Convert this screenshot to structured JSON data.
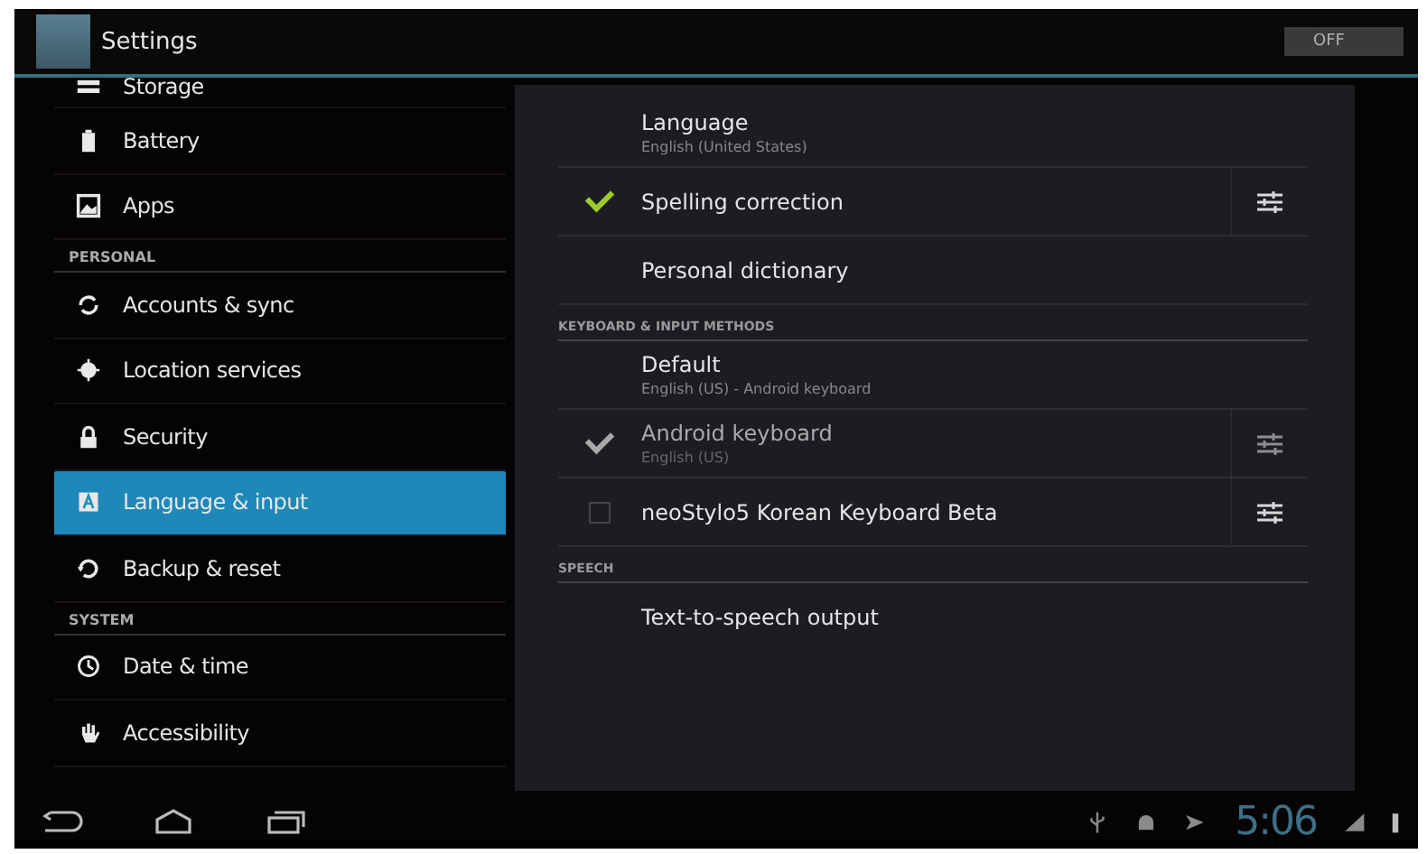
{
  "action_bar": {
    "title": "Settings",
    "toggle": {
      "label": "OFF",
      "on": false
    }
  },
  "sidebar": {
    "items": [
      {
        "kind": "item",
        "label": "Storage",
        "selected": false
      },
      {
        "kind": "item",
        "label": "Battery",
        "selected": false
      },
      {
        "kind": "item",
        "label": "Apps",
        "selected": false
      },
      {
        "kind": "header",
        "label": "PERSONAL"
      },
      {
        "kind": "item",
        "label": "Accounts & sync",
        "selected": false
      },
      {
        "kind": "item",
        "label": "Location services",
        "selected": false
      },
      {
        "kind": "item",
        "label": "Security",
        "selected": false
      },
      {
        "kind": "item",
        "label": "Language & input",
        "selected": true
      },
      {
        "kind": "item",
        "label": "Backup & reset",
        "selected": false
      },
      {
        "kind": "header",
        "label": "SYSTEM"
      },
      {
        "kind": "item",
        "label": "Date & time",
        "selected": false
      },
      {
        "kind": "item",
        "label": "Accessibility",
        "selected": false
      }
    ]
  },
  "detail": {
    "items": [
      {
        "kind": "option",
        "title": "Language",
        "summary": "English (United States)"
      },
      {
        "kind": "checkbox",
        "title": "Spelling correction",
        "checked": true,
        "disabled": false,
        "settings": true
      },
      {
        "kind": "option",
        "title": "Personal dictionary"
      },
      {
        "kind": "header",
        "title": "KEYBOARD & INPUT METHODS"
      },
      {
        "kind": "option",
        "title": "Default",
        "summary": "English (US) - Android keyboard"
      },
      {
        "kind": "checkbox",
        "title": "Android keyboard",
        "summary": "English (US)",
        "checked": true,
        "disabled": true,
        "settings": true
      },
      {
        "kind": "checkbox",
        "title": "neoStylo5 Korean Keyboard Beta",
        "checked": false,
        "disabled": false,
        "settings": true
      },
      {
        "kind": "header",
        "title": "SPEECH"
      },
      {
        "kind": "option",
        "title": "Text-to-speech output"
      }
    ]
  },
  "system_bar": {
    "time": "5:06"
  }
}
